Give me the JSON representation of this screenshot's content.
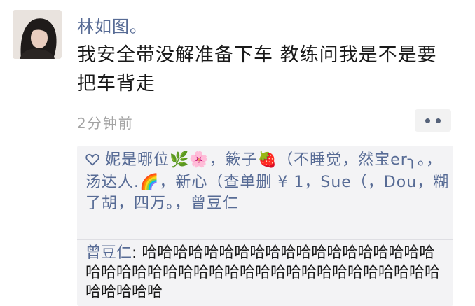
{
  "post": {
    "author": "林如图。",
    "text": "我安全带没解准备下车 教练问我是不是要把车背走",
    "timestamp": "2分钟前"
  },
  "likes": {
    "icon": "heart-outline-icon",
    "names_text": "妮是哪位🌿🌸，簌子🍓（不睡觉，然宝er╮。，汤达人.🌈，新心（查单删 ¥ 1，Sue（，Dou，糊了胡，四万。，曾豆仁"
  },
  "comments": [
    {
      "author": "曾豆仁",
      "separator": ": ",
      "text": "哈哈哈哈哈哈哈哈哈哈哈哈哈哈哈哈哈哈哈哈哈哈哈哈哈哈哈哈哈哈哈哈哈哈哈哈哈哈哈哈哈哈哈哈哈哈哈"
    }
  ],
  "colors": {
    "link": "#576b95",
    "panel": "#f3f3f5",
    "text": "#1a1a1a",
    "muted": "#a3a3a3"
  }
}
